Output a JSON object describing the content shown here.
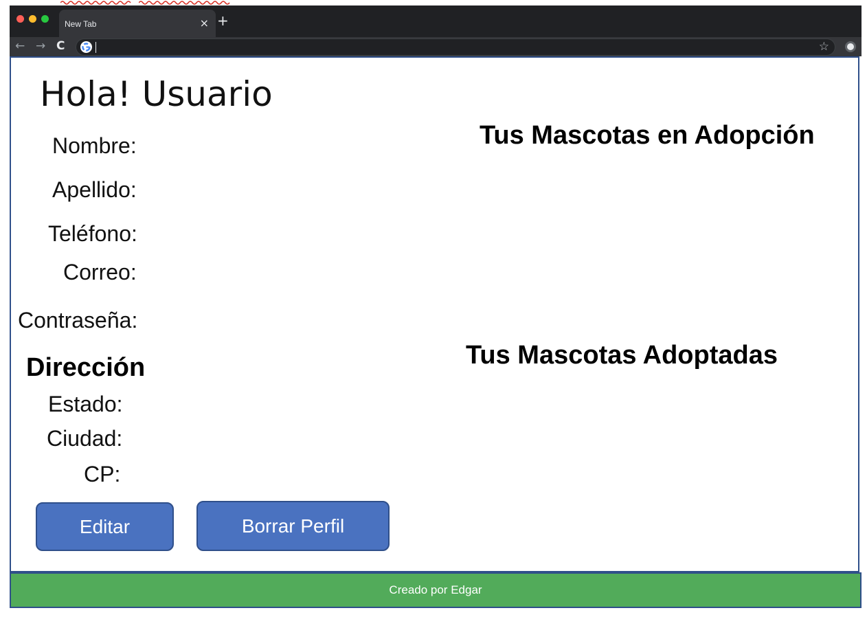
{
  "browser": {
    "tab_title": "New Tab",
    "tab_close": "×",
    "new_tab": "+",
    "back_icon": "←",
    "forward_icon": "→",
    "reload_icon": "C",
    "bookmark_icon": "☆",
    "address_value": ""
  },
  "profile": {
    "greeting": "Hola! Usuario",
    "fields": {
      "nombre": "Nombre:",
      "apellido": "Apellido:",
      "telefono": "Teléfono:",
      "correo": "Correo:",
      "contrasena": "Contraseña:"
    },
    "address_title": "Dirección",
    "address_fields": {
      "estado": "Estado:",
      "ciudad": "Ciudad:",
      "cp": "CP:"
    }
  },
  "actions": {
    "edit_label": "Editar",
    "delete_label": "Borrar Perfil"
  },
  "pets": {
    "in_adoption_title": "Tus Mascotas en Adopción",
    "adopted_title": "Tus Mascotas Adoptadas"
  },
  "footer": {
    "text": "Creado por Edgar"
  },
  "colors": {
    "button": "#4a72c0",
    "footer": "#52ab5a",
    "border": "#2f4f8a"
  }
}
